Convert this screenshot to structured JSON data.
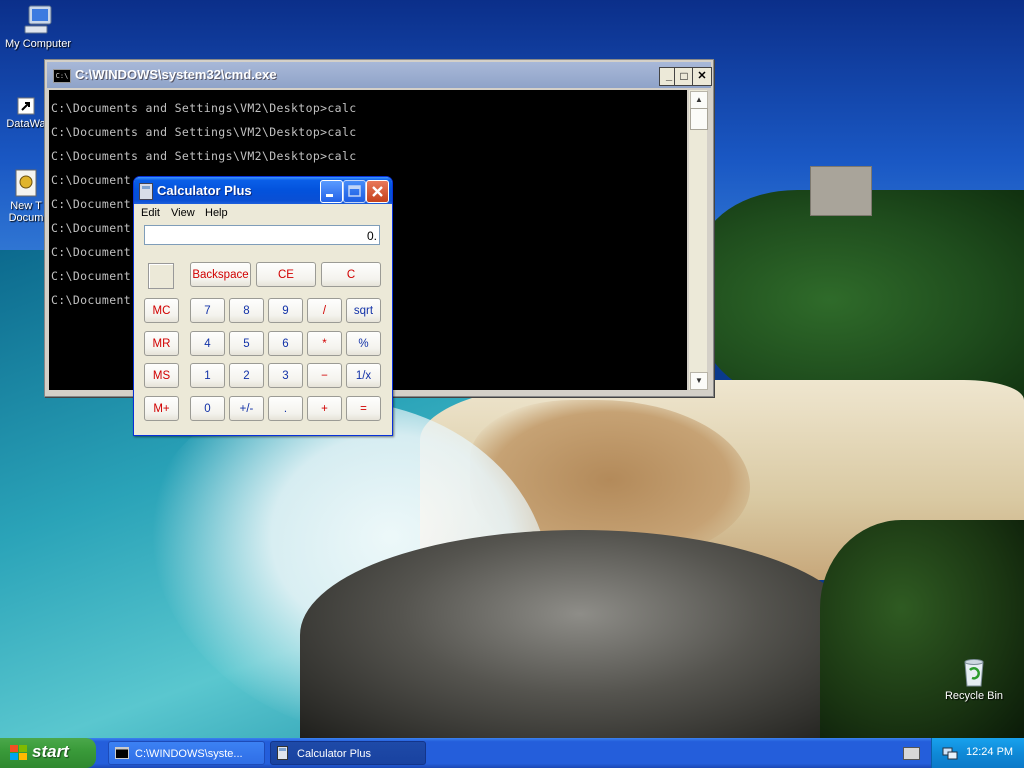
{
  "desktop": {
    "icons": [
      {
        "label": "My Computer"
      },
      {
        "label": "DataWa"
      },
      {
        "label": "New T\nDocum"
      },
      {
        "label": "Recycle Bin"
      }
    ]
  },
  "cmd_window": {
    "title": "C:\\WINDOWS\\system32\\cmd.exe",
    "minimize_label": "_",
    "maximize_label": "□",
    "close_label": "✕",
    "lines": [
      "C:\\Documents and Settings\\VM2\\Desktop>calc",
      "C:\\Documents and Settings\\VM2\\Desktop>calc",
      "C:\\Documents and Settings\\VM2\\Desktop>calc",
      "C:\\Document",
      "C:\\Document",
      "C:\\Document",
      "C:\\Document",
      "C:\\Document",
      "C:\\Document"
    ]
  },
  "calculator": {
    "title": "Calculator Plus",
    "menu": [
      "Edit",
      "View",
      "Help"
    ],
    "display": "0.",
    "top_buttons": [
      "Backspace",
      "CE",
      "C"
    ],
    "memory_buttons": [
      "MC",
      "MR",
      "MS",
      "M+"
    ],
    "rows": [
      [
        "7",
        "8",
        "9",
        "/",
        "sqrt"
      ],
      [
        "4",
        "5",
        "6",
        "*",
        "%"
      ],
      [
        "1",
        "2",
        "3",
        "−",
        "1/x"
      ],
      [
        "0",
        "+/-",
        ".",
        "+",
        "="
      ]
    ],
    "colors": {
      "red_text": "#d10000",
      "blue_text": "#1232a8"
    }
  },
  "taskbar": {
    "start_label": "start",
    "items": [
      {
        "label": "C:\\WINDOWS\\syste...",
        "state": "inactive",
        "icon": "cmd-icon"
      },
      {
        "label": "Calculator Plus",
        "state": "active",
        "icon": "calculator-icon"
      }
    ],
    "clock": "12:24 PM"
  }
}
